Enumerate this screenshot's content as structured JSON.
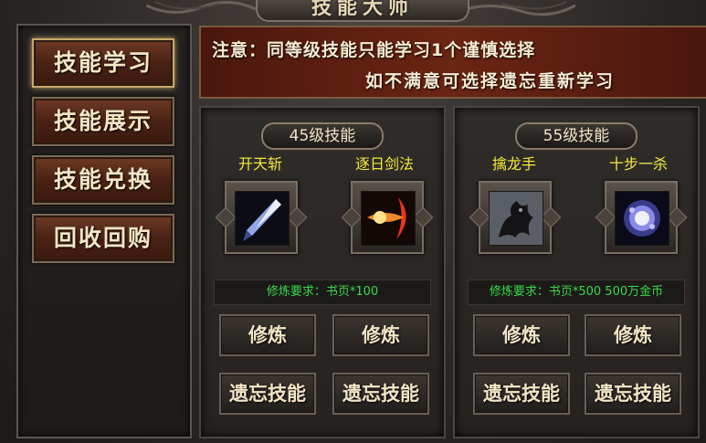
{
  "window": {
    "title": "技能大师"
  },
  "sidebar": {
    "items": [
      {
        "label": "技能学习",
        "active": true
      },
      {
        "label": "技能展示",
        "active": false
      },
      {
        "label": "技能兑换",
        "active": false
      },
      {
        "label": "回收回购",
        "active": false
      }
    ]
  },
  "notice": {
    "line1": "注意：同等级技能只能学习1个谨慎选择",
    "line2": "如不满意可选择遗忘重新学习"
  },
  "panels": [
    {
      "level_label": "45级技能",
      "skills": [
        {
          "name": "开天斩",
          "icon": "sword-slash-icon"
        },
        {
          "name": "逐日剑法",
          "icon": "fire-slash-icon"
        }
      ],
      "requirement": "修炼要求：书页*100",
      "train_label": "修炼",
      "forget_label": "遗忘技能"
    },
    {
      "level_label": "55级技能",
      "skills": [
        {
          "name": "擒龙手",
          "icon": "dragon-grab-icon"
        },
        {
          "name": "十步一杀",
          "icon": "spirit-orb-icon"
        }
      ],
      "requirement": "修炼要求：书页*500 500万金币",
      "train_label": "修炼",
      "forget_label": "遗忘技能"
    }
  ],
  "colors": {
    "skill_name": "#f4ea3c",
    "requirement": "#38d84a",
    "notice_bg": "#6b2513"
  }
}
